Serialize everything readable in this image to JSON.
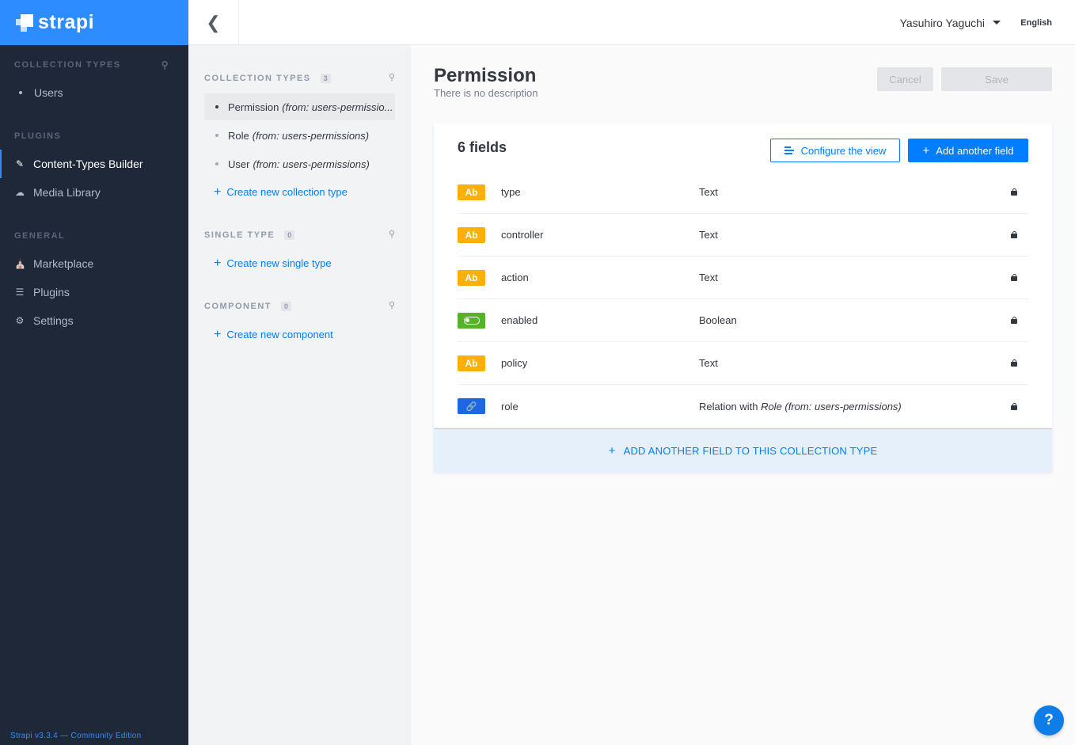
{
  "brand": {
    "name": "strapi"
  },
  "leftnav": {
    "collection_types_heading": "COLLECTION TYPES",
    "collection_items": [
      {
        "label": "Users"
      }
    ],
    "plugins_heading": "PLUGINS",
    "plugin_items": [
      {
        "label": "Content-Types Builder",
        "icon": "brush-icon"
      },
      {
        "label": "Media Library",
        "icon": "cloud-upload-icon"
      }
    ],
    "general_heading": "GENERAL",
    "general_items": [
      {
        "label": "Marketplace",
        "icon": "shopping-basket-icon"
      },
      {
        "label": "Plugins",
        "icon": "list-icon"
      },
      {
        "label": "Settings",
        "icon": "gear-icon"
      }
    ],
    "footer": "Strapi v3.3.4 — Community Edition"
  },
  "header": {
    "user_name": "Yasuhiro Yaguchi",
    "language": "English"
  },
  "subnav": {
    "collection_types": {
      "title": "COLLECTION TYPES",
      "count": "3",
      "items": [
        {
          "name": "Permission",
          "source": "(from: users-permissio..."
        },
        {
          "name": "Role",
          "source": "(from: users-permissions)"
        },
        {
          "name": "User",
          "source": "(from: users-permissions)"
        }
      ],
      "create_label": "Create new collection type"
    },
    "single_type": {
      "title": "SINGLE TYPE",
      "count": "0",
      "create_label": "Create new single type"
    },
    "component": {
      "title": "COMPONENT",
      "count": "0",
      "create_label": "Create new component"
    }
  },
  "main": {
    "title": "Permission",
    "description": "There is no description",
    "cancel_label": "Cancel",
    "save_label": "Save",
    "fields_title": "6 fields",
    "configure_label": "Configure the view",
    "add_field_label": "Add another field",
    "fields": [
      {
        "badge": "Ab",
        "kind": "text",
        "name": "type",
        "type": "Text"
      },
      {
        "badge": "Ab",
        "kind": "text",
        "name": "controller",
        "type": "Text"
      },
      {
        "badge": "Ab",
        "kind": "text",
        "name": "action",
        "type": "Text"
      },
      {
        "badge": "",
        "kind": "boolean",
        "name": "enabled",
        "type": "Boolean"
      },
      {
        "badge": "Ab",
        "kind": "text",
        "name": "policy",
        "type": "Text"
      },
      {
        "badge": "",
        "kind": "relation",
        "name": "role",
        "type": "Relation with",
        "target": "Role (from: users-permissions)"
      }
    ],
    "add_footer_label": "ADD ANOTHER FIELD TO THIS COLLECTION TYPE"
  },
  "help": {
    "label": "?"
  },
  "colors": {
    "brand_blue": "#2d8cff",
    "accent_blue": "#007eff",
    "sidebar_bg": "#1e2839",
    "text_badge": "#fab005",
    "boolean_badge": "#54b32a",
    "relation_badge": "#1f66e5"
  }
}
